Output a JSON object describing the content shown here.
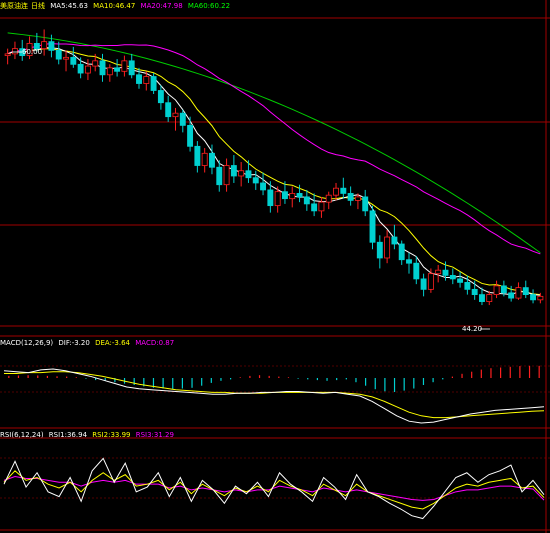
{
  "header": {
    "instrument": "美原油连",
    "period": "日线",
    "ma": [
      {
        "text": "MA5:45.63",
        "color": "#ffffff"
      },
      {
        "text": "MA10:46.47",
        "color": "#ffff00"
      },
      {
        "text": "MA20:47.98",
        "color": "#ff00ff"
      },
      {
        "text": "MA60:60.22",
        "color": "#00ff00"
      }
    ]
  },
  "macd_legend": {
    "label": "MACD(12,26,9)",
    "dif": {
      "text": "DIF:-3.20",
      "color": "#ffffff"
    },
    "dea": {
      "text": "DEA:-3.64",
      "color": "#ffff00"
    },
    "macd": {
      "text": "MACD:0.87",
      "color": "#ff00ff"
    }
  },
  "rsi_legend": {
    "label": "RSI(6,12,24)",
    "rsi1": {
      "text": "RSI1:36.94",
      "color": "#ffffff"
    },
    "rsi2": {
      "text": "RSI2:33.99",
      "color": "#ffff00"
    },
    "rsi3": {
      "text": "RSI3:31.29",
      "color": "#ff00ff"
    }
  },
  "annotations": {
    "high_marker": "60.00",
    "low_marker": "44.20"
  },
  "colors": {
    "up": "#ff2020",
    "down": "#00d0d0",
    "grid": "#a00000",
    "ma5": "#ffffff",
    "ma10": "#ffff00",
    "ma20": "#ff00ff",
    "ma60": "#00cc00"
  },
  "chart_data": {
    "type": "candlestick",
    "price_range": [
      43,
      61
    ],
    "ohlc": [
      [
        58.5,
        58.9,
        58.0,
        58.6
      ],
      [
        58.6,
        59.3,
        58.3,
        58.9
      ],
      [
        58.9,
        59.4,
        58.2,
        58.5
      ],
      [
        58.5,
        59.6,
        58.3,
        59.2
      ],
      [
        59.2,
        59.8,
        58.7,
        58.9
      ],
      [
        58.9,
        60.0,
        58.5,
        59.3
      ],
      [
        59.3,
        59.7,
        58.4,
        58.8
      ],
      [
        58.8,
        59.3,
        58.0,
        58.3
      ],
      [
        58.3,
        58.8,
        57.6,
        58.4
      ],
      [
        58.4,
        59.0,
        57.8,
        58.0
      ],
      [
        58.0,
        58.4,
        57.2,
        57.5
      ],
      [
        57.5,
        58.3,
        57.1,
        57.9
      ],
      [
        57.9,
        58.6,
        57.6,
        58.2
      ],
      [
        58.2,
        58.6,
        57.0,
        57.4
      ],
      [
        57.4,
        58.0,
        57.0,
        57.8
      ],
      [
        57.8,
        58.3,
        57.3,
        57.6
      ],
      [
        57.6,
        58.5,
        57.3,
        58.2
      ],
      [
        58.2,
        58.6,
        57.2,
        57.4
      ],
      [
        57.4,
        57.8,
        56.6,
        56.9
      ],
      [
        56.9,
        57.6,
        56.5,
        57.3
      ],
      [
        57.3,
        57.5,
        56.3,
        56.5
      ],
      [
        56.5,
        56.8,
        55.4,
        55.8
      ],
      [
        55.8,
        56.2,
        54.7,
        55.0
      ],
      [
        55.0,
        55.5,
        54.2,
        55.2
      ],
      [
        55.2,
        55.4,
        54.1,
        54.5
      ],
      [
        54.5,
        55.0,
        53.0,
        53.3
      ],
      [
        53.3,
        53.6,
        51.8,
        52.2
      ],
      [
        52.2,
        53.2,
        51.8,
        52.9
      ],
      [
        52.9,
        53.4,
        51.7,
        52.1
      ],
      [
        52.1,
        52.5,
        50.7,
        51.1
      ],
      [
        51.1,
        52.6,
        50.7,
        52.2
      ],
      [
        52.2,
        52.8,
        51.2,
        51.6
      ],
      [
        51.6,
        52.4,
        51.0,
        51.9
      ],
      [
        51.9,
        52.5,
        51.2,
        51.5
      ],
      [
        51.5,
        51.9,
        50.8,
        51.2
      ],
      [
        51.2,
        51.8,
        50.5,
        50.8
      ],
      [
        50.8,
        51.3,
        49.5,
        49.9
      ],
      [
        49.9,
        51.0,
        49.5,
        50.7
      ],
      [
        50.7,
        51.3,
        50.0,
        50.3
      ],
      [
        50.3,
        51.0,
        49.8,
        50.6
      ],
      [
        50.6,
        51.1,
        50.1,
        50.4
      ],
      [
        50.4,
        50.8,
        49.6,
        50.0
      ],
      [
        50.0,
        50.6,
        49.3,
        49.6
      ],
      [
        49.6,
        50.4,
        49.2,
        50.1
      ],
      [
        50.1,
        50.7,
        49.7,
        50.5
      ],
      [
        50.5,
        51.2,
        50.2,
        50.9
      ],
      [
        50.9,
        51.5,
        50.3,
        50.6
      ],
      [
        50.6,
        51.0,
        49.9,
        50.2
      ],
      [
        50.2,
        50.6,
        49.7,
        50.4
      ],
      [
        50.4,
        50.8,
        49.3,
        49.6
      ],
      [
        49.6,
        49.9,
        47.4,
        47.8
      ],
      [
        47.8,
        48.2,
        46.3,
        46.9
      ],
      [
        46.9,
        48.5,
        46.6,
        48.1
      ],
      [
        48.1,
        48.8,
        47.4,
        47.7
      ],
      [
        47.7,
        47.9,
        46.5,
        46.8
      ],
      [
        46.8,
        47.2,
        46.0,
        46.6
      ],
      [
        46.6,
        47.0,
        45.4,
        45.7
      ],
      [
        45.7,
        46.0,
        44.7,
        45.1
      ],
      [
        45.1,
        46.3,
        44.9,
        46.0
      ],
      [
        46.0,
        46.5,
        45.5,
        46.2
      ],
      [
        46.2,
        46.7,
        45.6,
        45.9
      ],
      [
        45.9,
        46.3,
        45.4,
        45.7
      ],
      [
        45.7,
        46.1,
        45.2,
        45.5
      ],
      [
        45.5,
        45.9,
        44.8,
        45.1
      ],
      [
        45.1,
        45.6,
        44.5,
        44.8
      ],
      [
        44.8,
        45.2,
        44.2,
        44.4
      ],
      [
        44.4,
        45.0,
        44.2,
        44.8
      ],
      [
        44.8,
        45.6,
        44.6,
        45.3
      ],
      [
        45.3,
        45.6,
        44.7,
        44.9
      ],
      [
        44.9,
        45.3,
        44.4,
        44.6
      ],
      [
        44.6,
        45.5,
        44.5,
        45.2
      ],
      [
        45.2,
        45.6,
        44.6,
        44.8
      ],
      [
        44.8,
        45.1,
        44.3,
        44.5
      ],
      [
        44.5,
        44.9,
        44.3,
        44.7
      ]
    ],
    "ma60_endpoints": [
      59.8,
      47.2
    ],
    "macd_hist": [
      0.15,
      0.18,
      0.2,
      0.18,
      0.15,
      0.12,
      0.1,
      0.05,
      -0.05,
      -0.15,
      -0.2,
      -0.3,
      -0.4,
      -0.5,
      -0.6,
      -0.7,
      -0.75,
      -0.8,
      -0.75,
      -0.7,
      -0.55,
      -0.35,
      -0.2,
      -0.1,
      0.05,
      0.15,
      0.2,
      0.15,
      0.1,
      0.05,
      -0.05,
      -0.1,
      -0.15,
      -0.2,
      -0.15,
      -0.1,
      -0.3,
      -0.55,
      -0.8,
      -0.95,
      -1.0,
      -0.9,
      -0.75,
      -0.5,
      -0.3,
      -0.1,
      0.1,
      0.3,
      0.45,
      0.6,
      0.7,
      0.75,
      0.8,
      0.85,
      0.87,
      0.87
    ],
    "macd_dif": [
      0.8,
      0.7,
      0.6,
      0.9,
      1.0,
      0.8,
      0.5,
      0.2,
      -0.2,
      -0.6,
      -1.0,
      -1.2,
      -1.3,
      -1.4,
      -1.5,
      -1.6,
      -1.7,
      -1.8,
      -1.8,
      -1.7,
      -1.7,
      -1.6,
      -1.6,
      -1.5,
      -1.5,
      -1.6,
      -1.7,
      -1.6,
      -1.8,
      -2.0,
      -2.6,
      -3.4,
      -4.2,
      -4.8,
      -5.0,
      -4.9,
      -4.6,
      -4.3,
      -4.0,
      -3.8,
      -3.6,
      -3.5,
      -3.4,
      -3.3,
      -3.2
    ],
    "macd_dea": [
      0.5,
      0.5,
      0.6,
      0.6,
      0.7,
      0.7,
      0.6,
      0.4,
      0.2,
      -0.1,
      -0.4,
      -0.7,
      -0.9,
      -1.1,
      -1.3,
      -1.4,
      -1.5,
      -1.6,
      -1.6,
      -1.7,
      -1.7,
      -1.7,
      -1.6,
      -1.6,
      -1.6,
      -1.6,
      -1.6,
      -1.6,
      -1.7,
      -1.8,
      -2.1,
      -2.6,
      -3.2,
      -3.8,
      -4.2,
      -4.4,
      -4.4,
      -4.3,
      -4.2,
      -4.1,
      -4.0,
      -3.9,
      -3.8,
      -3.7,
      -3.64
    ],
    "rsi1": [
      48,
      72,
      45,
      60,
      40,
      35,
      55,
      30,
      62,
      75,
      50,
      70,
      40,
      45,
      60,
      35,
      55,
      30,
      52,
      42,
      28,
      46,
      38,
      50,
      35,
      60,
      48,
      40,
      30,
      55,
      45,
      32,
      58,
      40,
      35,
      28,
      22,
      15,
      12,
      25,
      40,
      55,
      60,
      50,
      58,
      62,
      68,
      40,
      52,
      36.94
    ],
    "rsi2": [
      50,
      62,
      52,
      55,
      48,
      44,
      50,
      40,
      52,
      60,
      52,
      58,
      46,
      48,
      52,
      42,
      50,
      38,
      48,
      42,
      36,
      44,
      40,
      46,
      40,
      52,
      46,
      42,
      36,
      48,
      42,
      36,
      48,
      40,
      36,
      32,
      28,
      24,
      22,
      28,
      36,
      44,
      48,
      46,
      50,
      52,
      54,
      44,
      46,
      33.99
    ],
    "rsi3": [
      52,
      56,
      54,
      54,
      52,
      50,
      50,
      46,
      50,
      52,
      50,
      52,
      48,
      48,
      48,
      44,
      46,
      42,
      44,
      42,
      40,
      42,
      40,
      42,
      42,
      46,
      44,
      42,
      40,
      44,
      42,
      40,
      42,
      40,
      38,
      36,
      34,
      32,
      31,
      32,
      36,
      40,
      42,
      42,
      44,
      46,
      46,
      44,
      43,
      31.29
    ]
  }
}
